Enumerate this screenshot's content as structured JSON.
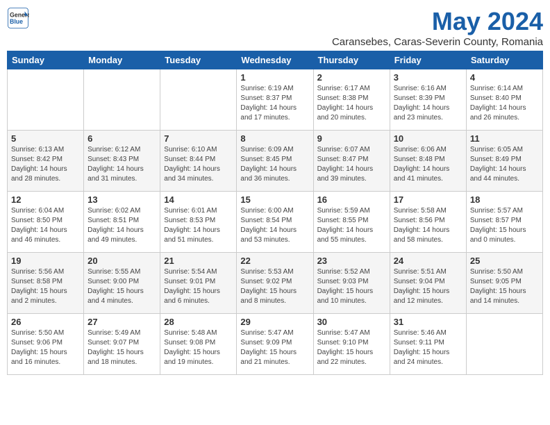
{
  "app": {
    "logo_general": "General",
    "logo_blue": "Blue",
    "month_title": "May 2024",
    "subtitle": "Caransebes, Caras-Severin County, Romania"
  },
  "calendar": {
    "headers": [
      "Sunday",
      "Monday",
      "Tuesday",
      "Wednesday",
      "Thursday",
      "Friday",
      "Saturday"
    ],
    "weeks": [
      [
        {
          "day": "",
          "info": ""
        },
        {
          "day": "",
          "info": ""
        },
        {
          "day": "",
          "info": ""
        },
        {
          "day": "1",
          "info": "Sunrise: 6:19 AM\nSunset: 8:37 PM\nDaylight: 14 hours\nand 17 minutes."
        },
        {
          "day": "2",
          "info": "Sunrise: 6:17 AM\nSunset: 8:38 PM\nDaylight: 14 hours\nand 20 minutes."
        },
        {
          "day": "3",
          "info": "Sunrise: 6:16 AM\nSunset: 8:39 PM\nDaylight: 14 hours\nand 23 minutes."
        },
        {
          "day": "4",
          "info": "Sunrise: 6:14 AM\nSunset: 8:40 PM\nDaylight: 14 hours\nand 26 minutes."
        }
      ],
      [
        {
          "day": "5",
          "info": "Sunrise: 6:13 AM\nSunset: 8:42 PM\nDaylight: 14 hours\nand 28 minutes."
        },
        {
          "day": "6",
          "info": "Sunrise: 6:12 AM\nSunset: 8:43 PM\nDaylight: 14 hours\nand 31 minutes."
        },
        {
          "day": "7",
          "info": "Sunrise: 6:10 AM\nSunset: 8:44 PM\nDaylight: 14 hours\nand 34 minutes."
        },
        {
          "day": "8",
          "info": "Sunrise: 6:09 AM\nSunset: 8:45 PM\nDaylight: 14 hours\nand 36 minutes."
        },
        {
          "day": "9",
          "info": "Sunrise: 6:07 AM\nSunset: 8:47 PM\nDaylight: 14 hours\nand 39 minutes."
        },
        {
          "day": "10",
          "info": "Sunrise: 6:06 AM\nSunset: 8:48 PM\nDaylight: 14 hours\nand 41 minutes."
        },
        {
          "day": "11",
          "info": "Sunrise: 6:05 AM\nSunset: 8:49 PM\nDaylight: 14 hours\nand 44 minutes."
        }
      ],
      [
        {
          "day": "12",
          "info": "Sunrise: 6:04 AM\nSunset: 8:50 PM\nDaylight: 14 hours\nand 46 minutes."
        },
        {
          "day": "13",
          "info": "Sunrise: 6:02 AM\nSunset: 8:51 PM\nDaylight: 14 hours\nand 49 minutes."
        },
        {
          "day": "14",
          "info": "Sunrise: 6:01 AM\nSunset: 8:53 PM\nDaylight: 14 hours\nand 51 minutes."
        },
        {
          "day": "15",
          "info": "Sunrise: 6:00 AM\nSunset: 8:54 PM\nDaylight: 14 hours\nand 53 minutes."
        },
        {
          "day": "16",
          "info": "Sunrise: 5:59 AM\nSunset: 8:55 PM\nDaylight: 14 hours\nand 55 minutes."
        },
        {
          "day": "17",
          "info": "Sunrise: 5:58 AM\nSunset: 8:56 PM\nDaylight: 14 hours\nand 58 minutes."
        },
        {
          "day": "18",
          "info": "Sunrise: 5:57 AM\nSunset: 8:57 PM\nDaylight: 15 hours\nand 0 minutes."
        }
      ],
      [
        {
          "day": "19",
          "info": "Sunrise: 5:56 AM\nSunset: 8:58 PM\nDaylight: 15 hours\nand 2 minutes."
        },
        {
          "day": "20",
          "info": "Sunrise: 5:55 AM\nSunset: 9:00 PM\nDaylight: 15 hours\nand 4 minutes."
        },
        {
          "day": "21",
          "info": "Sunrise: 5:54 AM\nSunset: 9:01 PM\nDaylight: 15 hours\nand 6 minutes."
        },
        {
          "day": "22",
          "info": "Sunrise: 5:53 AM\nSunset: 9:02 PM\nDaylight: 15 hours\nand 8 minutes."
        },
        {
          "day": "23",
          "info": "Sunrise: 5:52 AM\nSunset: 9:03 PM\nDaylight: 15 hours\nand 10 minutes."
        },
        {
          "day": "24",
          "info": "Sunrise: 5:51 AM\nSunset: 9:04 PM\nDaylight: 15 hours\nand 12 minutes."
        },
        {
          "day": "25",
          "info": "Sunrise: 5:50 AM\nSunset: 9:05 PM\nDaylight: 15 hours\nand 14 minutes."
        }
      ],
      [
        {
          "day": "26",
          "info": "Sunrise: 5:50 AM\nSunset: 9:06 PM\nDaylight: 15 hours\nand 16 minutes."
        },
        {
          "day": "27",
          "info": "Sunrise: 5:49 AM\nSunset: 9:07 PM\nDaylight: 15 hours\nand 18 minutes."
        },
        {
          "day": "28",
          "info": "Sunrise: 5:48 AM\nSunset: 9:08 PM\nDaylight: 15 hours\nand 19 minutes."
        },
        {
          "day": "29",
          "info": "Sunrise: 5:47 AM\nSunset: 9:09 PM\nDaylight: 15 hours\nand 21 minutes."
        },
        {
          "day": "30",
          "info": "Sunrise: 5:47 AM\nSunset: 9:10 PM\nDaylight: 15 hours\nand 22 minutes."
        },
        {
          "day": "31",
          "info": "Sunrise: 5:46 AM\nSunset: 9:11 PM\nDaylight: 15 hours\nand 24 minutes."
        },
        {
          "day": "",
          "info": ""
        }
      ]
    ]
  }
}
